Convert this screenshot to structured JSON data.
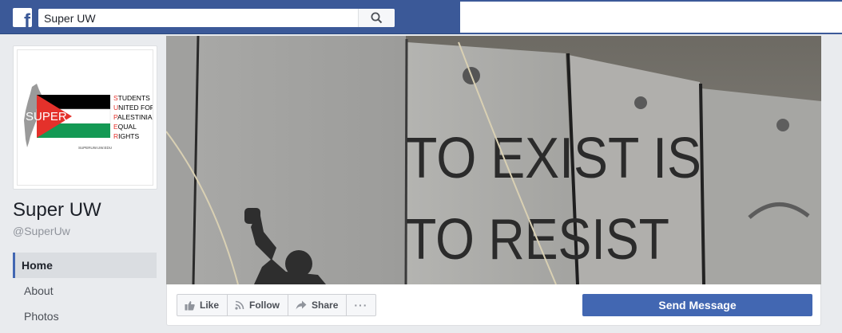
{
  "topbar": {
    "logo_letter": "f",
    "search_value": "Super UW"
  },
  "page": {
    "name": "Super UW",
    "handle": "@SuperUw"
  },
  "logo": {
    "acronym": "SUPER",
    "lines": [
      "STUDENTS",
      "UNITED FOR",
      "PALESTINIAN",
      "EQUAL",
      "RIGHTS"
    ],
    "url": "SUPERUW.UW.EDU"
  },
  "cover": {
    "line1": "TO EXIST IS",
    "line2": "TO RESIST"
  },
  "nav": [
    {
      "label": "Home",
      "active": true
    },
    {
      "label": "About",
      "active": false
    },
    {
      "label": "Photos",
      "active": false
    }
  ],
  "actions": {
    "like": "Like",
    "follow": "Follow",
    "share": "Share",
    "more": "···",
    "send_message": "Send Message"
  },
  "colors": {
    "brand": "#3b5998",
    "button": "#4267b2",
    "flag_red": "#e4312b",
    "flag_green": "#149954"
  }
}
